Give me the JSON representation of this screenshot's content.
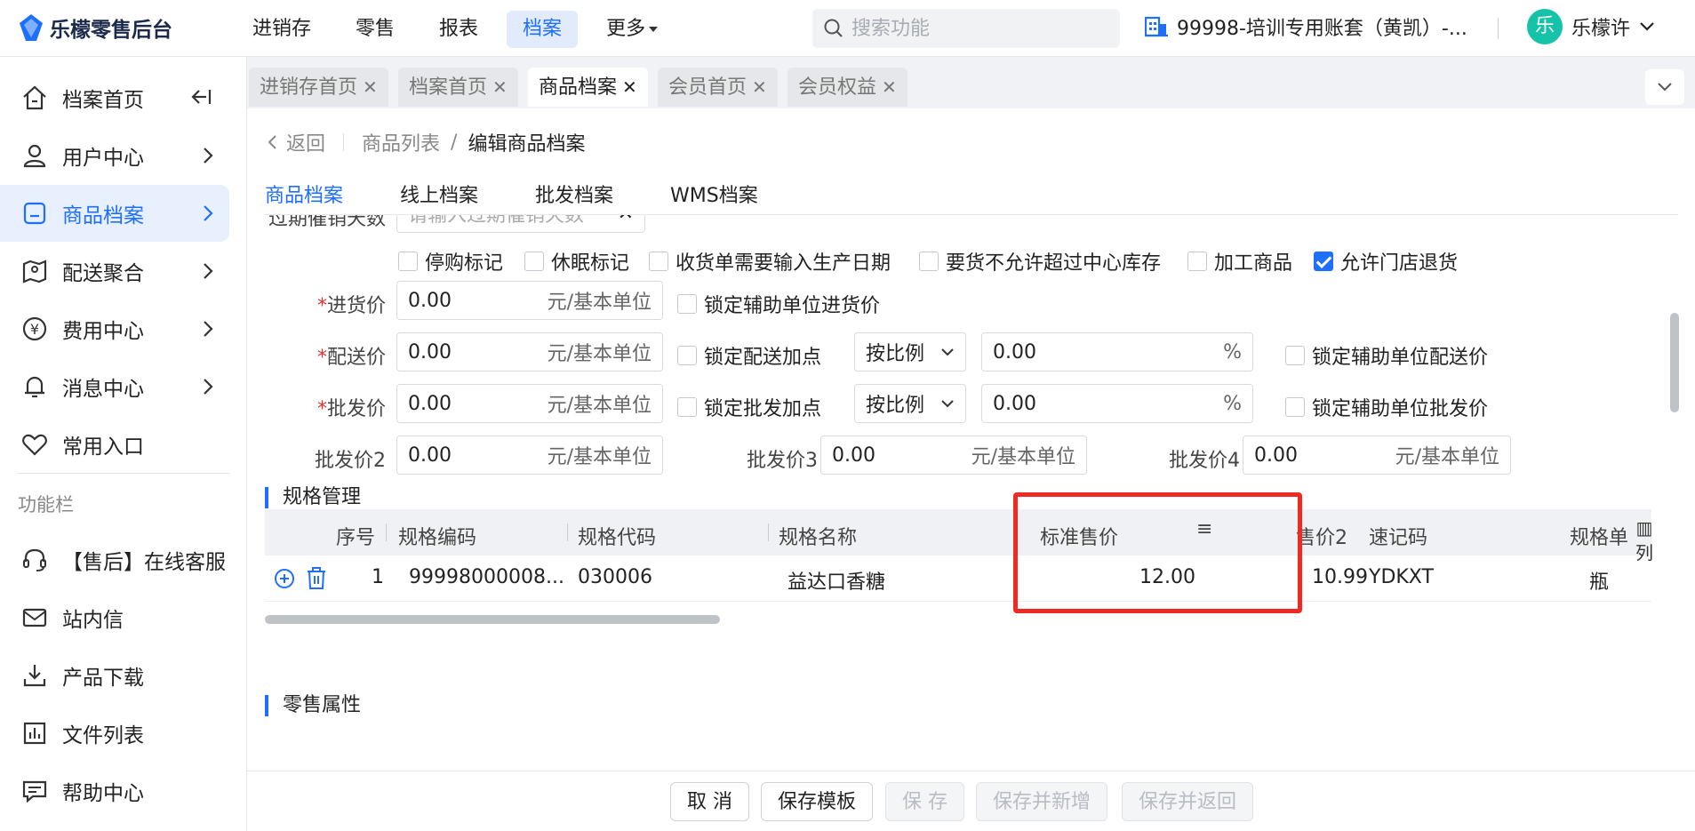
{
  "app": {
    "name": "乐檬零售后台"
  },
  "top_nav": [
    {
      "label": "进销存",
      "active": false
    },
    {
      "label": "零售",
      "active": false
    },
    {
      "label": "报表",
      "active": false
    },
    {
      "label": "档案",
      "active": true
    },
    {
      "label": "更多",
      "active": false
    }
  ],
  "search": {
    "placeholder": "搜索功能"
  },
  "account": {
    "label": "99998-培训专用账套（黄凯）-..."
  },
  "user": {
    "avatar": "乐",
    "name": "乐檬许"
  },
  "sidebar": {
    "items": [
      {
        "label": "档案首页"
      },
      {
        "label": "用户中心"
      },
      {
        "label": "商品档案"
      },
      {
        "label": "配送聚合"
      },
      {
        "label": "费用中心"
      },
      {
        "label": "消息中心"
      },
      {
        "label": "常用入口"
      }
    ],
    "section_label": "功能栏",
    "func_items": [
      {
        "label": "【售后】在线客服"
      },
      {
        "label": "站内信"
      },
      {
        "label": "产品下载"
      },
      {
        "label": "文件列表"
      },
      {
        "label": "帮助中心"
      }
    ]
  },
  "tabs": [
    {
      "label": "进销存首页"
    },
    {
      "label": "档案首页"
    },
    {
      "label": "商品档案"
    },
    {
      "label": "会员首页"
    },
    {
      "label": "会员权益"
    }
  ],
  "breadcrumb": {
    "back": "返回",
    "parent": "商品列表",
    "sep": "/",
    "current": "编辑商品档案"
  },
  "subtabs": [
    {
      "label": "商品档案"
    },
    {
      "label": "线上档案"
    },
    {
      "label": "批发档案"
    },
    {
      "label": "WMS档案"
    }
  ],
  "partial_field": {
    "label": "过期催销天数",
    "placeholder": "请输入过期催销天数",
    "clear": "✕"
  },
  "flags": [
    {
      "label": "停购标记",
      "checked": false
    },
    {
      "label": "休眠标记",
      "checked": false
    },
    {
      "label": "收货单需要输入生产日期",
      "checked": false
    },
    {
      "label": "要货不允许超过中心库存",
      "checked": false
    },
    {
      "label": "加工商品",
      "checked": false
    },
    {
      "label": "允许门店退货",
      "checked": true
    }
  ],
  "prices": {
    "required_mark": "*",
    "purchase": {
      "label": "进货价",
      "value": "0.00",
      "unit": "元/基本单位",
      "lock_label": "锁定辅助单位进货价"
    },
    "delivery": {
      "label": "配送价",
      "value": "0.00",
      "unit": "元/基本单位",
      "lock_label": "锁定配送加点",
      "mode": "按比例",
      "pct_value": "0.00",
      "pct_unit": "%",
      "lock_aux_label": "锁定辅助单位配送价"
    },
    "wholesale": {
      "label": "批发价",
      "value": "0.00",
      "unit": "元/基本单位",
      "lock_label": "锁定批发加点",
      "mode": "按比例",
      "pct_value": "0.00",
      "pct_unit": "%",
      "lock_aux_label": "锁定辅助单位批发价"
    },
    "wholesale2": {
      "label": "批发价2",
      "value": "0.00",
      "unit": "元/基本单位"
    },
    "wholesale3": {
      "label": "批发价3",
      "value": "0.00",
      "unit": "元/基本单位"
    },
    "wholesale4": {
      "label": "批发价4",
      "value": "0.00",
      "unit": "元/基本单位"
    }
  },
  "spec_section": {
    "title": "规格管理"
  },
  "spec_table": {
    "columns": [
      "序号",
      "规格编码",
      "规格代码",
      "规格名称",
      "标准售价",
      "售价2",
      "速记码",
      "规格单"
    ],
    "col_menu_icon": "≡",
    "col_setting": {
      "icon": "▥",
      "label": "列"
    },
    "rows": [
      {
        "index": "1",
        "code": "99998000008...",
        "spec_code": "030006",
        "name": "益达口香糖",
        "std_price": "12.00",
        "price2": "10.99",
        "mnemonic": "YDKXT",
        "unit": "瓶"
      }
    ]
  },
  "retail_section": {
    "title": "零售属性"
  },
  "buttons": {
    "cancel": "取 消",
    "save_template": "保存模板",
    "save": "保 存",
    "save_new": "保存并新增",
    "save_return": "保存并返回"
  },
  "colors": {
    "primary": "#1f6fff",
    "highlight_box": "#ee2a24",
    "required": "#e5322d"
  }
}
